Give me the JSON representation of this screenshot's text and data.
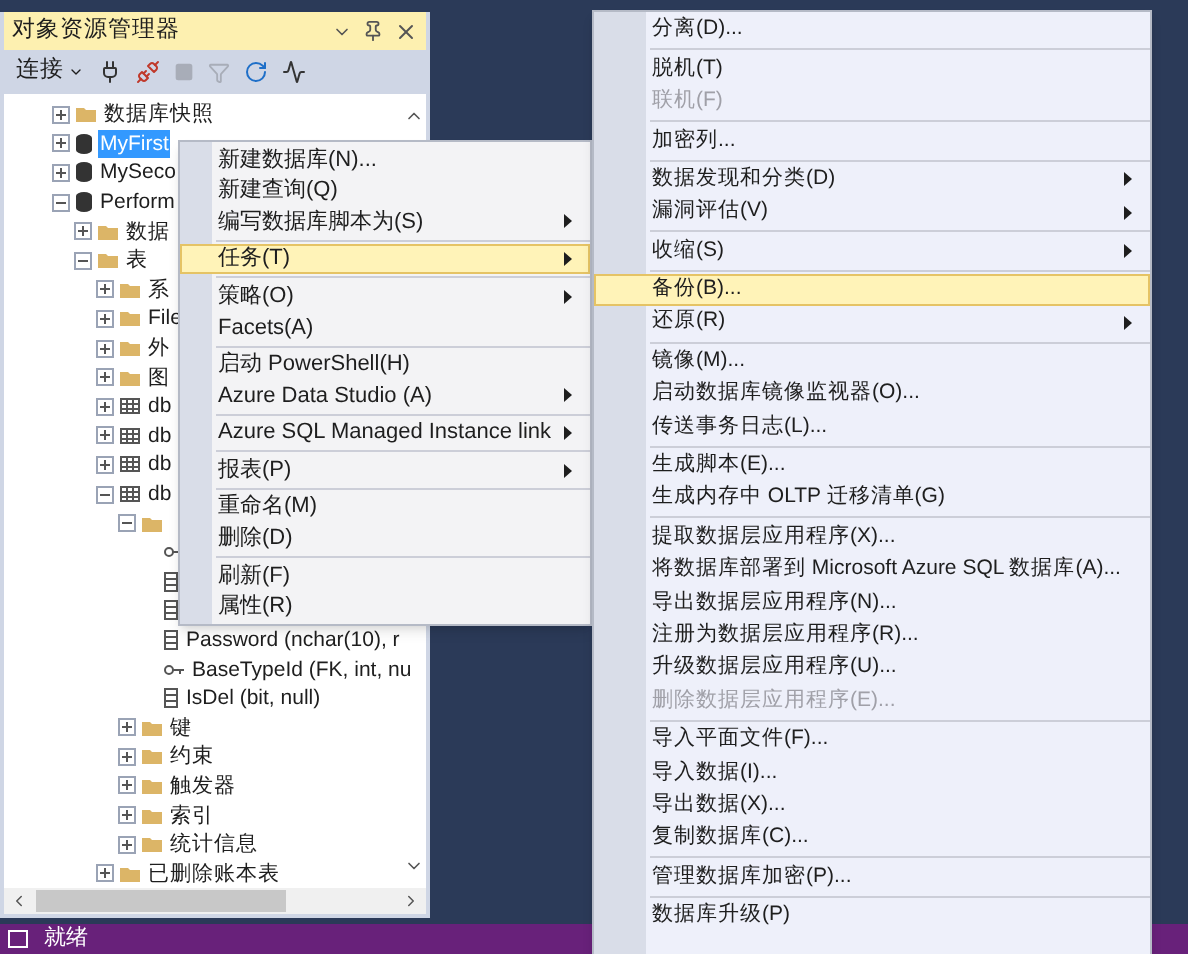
{
  "panel": {
    "title": "对象资源管理器",
    "toolbar": {
      "connect": "连接"
    }
  },
  "tree": [
    {
      "label": "数据库快照",
      "kind": "folder",
      "expanded": false,
      "selected": false
    },
    {
      "label": "MyFirst",
      "kind": "database",
      "expanded": false,
      "selected": true
    },
    {
      "label": "MySeco",
      "kind": "database",
      "expanded": false,
      "selected": false
    },
    {
      "label": "Perform",
      "kind": "database",
      "expanded": true,
      "selected": false,
      "children": [
        {
          "label": "数据",
          "kind": "folder",
          "expanded": false,
          "selected": false
        },
        {
          "label": "表",
          "kind": "folder",
          "expanded": true,
          "selected": false,
          "children": [
            {
              "label": "系",
              "kind": "folder",
              "expanded": false,
              "selected": false
            },
            {
              "label": "File",
              "kind": "folder",
              "expanded": false,
              "selected": false
            },
            {
              "label": "外",
              "kind": "folder",
              "expanded": false,
              "selected": false
            },
            {
              "label": "图",
              "kind": "folder",
              "expanded": false,
              "selected": false
            },
            {
              "label": "db",
              "kind": "table",
              "expanded": false,
              "selected": false
            },
            {
              "label": "db",
              "kind": "table",
              "expanded": false,
              "selected": false
            },
            {
              "label": "db",
              "kind": "table",
              "expanded": false,
              "selected": false
            },
            {
              "label": "db",
              "kind": "table",
              "expanded": true,
              "selected": false,
              "children": [
                {
                  "kind": "folder",
                  "expanded": true,
                  "selected": false,
                  "children": [
                    {
                      "kind": "key",
                      "selected": false
                    },
                    {
                      "kind": "column",
                      "selected": false
                    },
                    {
                      "kind": "column",
                      "selected": false
                    },
                    {
                      "label": "Password (nchar(10), r",
                      "kind": "column",
                      "selected": false
                    },
                    {
                      "label": "BaseTypeId (FK, int, nu",
                      "kind": "key",
                      "selected": false
                    },
                    {
                      "label": "IsDel (bit, null)",
                      "kind": "column",
                      "selected": false
                    }
                  ]
                },
                {
                  "label": "键",
                  "kind": "folder",
                  "expanded": false,
                  "selected": false
                },
                {
                  "label": "约束",
                  "kind": "folder",
                  "expanded": false,
                  "selected": false
                },
                {
                  "label": "触发器",
                  "kind": "folder",
                  "expanded": false,
                  "selected": false
                },
                {
                  "label": "索引",
                  "kind": "folder",
                  "expanded": false,
                  "selected": false
                },
                {
                  "label": "统计信息",
                  "kind": "folder",
                  "expanded": false,
                  "selected": false
                }
              ]
            },
            {
              "label": "已删除账本表",
              "kind": "folder",
              "expanded": false,
              "selected": false
            }
          ]
        }
      ]
    }
  ],
  "context_menu": [
    {
      "kind": "item",
      "label": "新建数据库(N)...",
      "selected": false,
      "disabled": false,
      "submenu": false
    },
    {
      "kind": "item",
      "label": "新建查询(Q)",
      "selected": false,
      "disabled": false,
      "submenu": false
    },
    {
      "kind": "item",
      "label": "编写数据库脚本为(S)",
      "selected": false,
      "disabled": false,
      "submenu": true
    },
    {
      "kind": "separator"
    },
    {
      "kind": "item",
      "label": "任务(T)",
      "selected": true,
      "disabled": false,
      "submenu": true
    },
    {
      "kind": "separator"
    },
    {
      "kind": "item",
      "label": "策略(O)",
      "selected": false,
      "disabled": false,
      "submenu": true
    },
    {
      "kind": "item",
      "label": "Facets(A)",
      "selected": false,
      "disabled": false,
      "submenu": false
    },
    {
      "kind": "separator"
    },
    {
      "kind": "item",
      "label": "启动 PowerShell(H)",
      "selected": false,
      "disabled": false,
      "submenu": false
    },
    {
      "kind": "item",
      "label": "Azure Data Studio (A)",
      "selected": false,
      "disabled": false,
      "submenu": true
    },
    {
      "kind": "separator"
    },
    {
      "kind": "item",
      "label": "Azure SQL Managed Instance link",
      "selected": false,
      "disabled": false,
      "submenu": true
    },
    {
      "kind": "separator"
    },
    {
      "kind": "item",
      "label": "报表(P)",
      "selected": false,
      "disabled": false,
      "submenu": true
    },
    {
      "kind": "separator"
    },
    {
      "kind": "item",
      "label": "重命名(M)",
      "selected": false,
      "disabled": false,
      "submenu": false
    },
    {
      "kind": "item",
      "label": "删除(D)",
      "selected": false,
      "disabled": false,
      "submenu": false
    },
    {
      "kind": "separator"
    },
    {
      "kind": "item",
      "label": "刷新(F)",
      "selected": false,
      "disabled": false,
      "submenu": false
    },
    {
      "kind": "item",
      "label": "属性(R)",
      "selected": false,
      "disabled": false,
      "submenu": false
    }
  ],
  "tasks_submenu": [
    {
      "kind": "item",
      "label": "分离(D)...",
      "selected": false,
      "disabled": false,
      "submenu": false
    },
    {
      "kind": "separator"
    },
    {
      "kind": "item",
      "label": "脱机(T)",
      "selected": false,
      "disabled": false,
      "submenu": false
    },
    {
      "kind": "item",
      "label": "联机(F)",
      "selected": false,
      "disabled": true,
      "submenu": false
    },
    {
      "kind": "separator"
    },
    {
      "kind": "item",
      "label": "加密列...",
      "selected": false,
      "disabled": false,
      "submenu": false
    },
    {
      "kind": "separator"
    },
    {
      "kind": "item",
      "label": "数据发现和分类(D)",
      "selected": false,
      "disabled": false,
      "submenu": true
    },
    {
      "kind": "item",
      "label": "漏洞评估(V)",
      "selected": false,
      "disabled": false,
      "submenu": true
    },
    {
      "kind": "separator"
    },
    {
      "kind": "item",
      "label": "收缩(S)",
      "selected": false,
      "disabled": false,
      "submenu": true
    },
    {
      "kind": "separator"
    },
    {
      "kind": "item",
      "label": "备份(B)...",
      "selected": true,
      "disabled": false,
      "submenu": false
    },
    {
      "kind": "item",
      "label": "还原(R)",
      "selected": false,
      "disabled": false,
      "submenu": true
    },
    {
      "kind": "separator"
    },
    {
      "kind": "item",
      "label": "镜像(M)...",
      "selected": false,
      "disabled": false,
      "submenu": false
    },
    {
      "kind": "item",
      "label": "启动数据库镜像监视器(O)...",
      "selected": false,
      "disabled": false,
      "submenu": false
    },
    {
      "kind": "item",
      "label": "传送事务日志(L)...",
      "selected": false,
      "disabled": false,
      "submenu": false
    },
    {
      "kind": "separator"
    },
    {
      "kind": "item",
      "label": "生成脚本(E)...",
      "selected": false,
      "disabled": false,
      "submenu": false
    },
    {
      "kind": "item",
      "label": "生成内存中 OLTP 迁移清单(G)",
      "selected": false,
      "disabled": false,
      "submenu": false
    },
    {
      "kind": "separator"
    },
    {
      "kind": "item",
      "label": "提取数据层应用程序(X)...",
      "selected": false,
      "disabled": false,
      "submenu": false
    },
    {
      "kind": "item",
      "label": "将数据库部署到 Microsoft Azure SQL 数据库(A)...",
      "selected": false,
      "disabled": false,
      "submenu": false
    },
    {
      "kind": "item",
      "label": "导出数据层应用程序(N)...",
      "selected": false,
      "disabled": false,
      "submenu": false
    },
    {
      "kind": "item",
      "label": "注册为数据层应用程序(R)...",
      "selected": false,
      "disabled": false,
      "submenu": false
    },
    {
      "kind": "item",
      "label": "升级数据层应用程序(U)...",
      "selected": false,
      "disabled": false,
      "submenu": false
    },
    {
      "kind": "item",
      "label": "删除数据层应用程序(E)...",
      "selected": false,
      "disabled": true,
      "submenu": false
    },
    {
      "kind": "separator"
    },
    {
      "kind": "item",
      "label": "导入平面文件(F)...",
      "selected": false,
      "disabled": false,
      "submenu": false
    },
    {
      "kind": "item",
      "label": "导入数据(I)...",
      "selected": false,
      "disabled": false,
      "submenu": false
    },
    {
      "kind": "item",
      "label": "导出数据(X)...",
      "selected": false,
      "disabled": false,
      "submenu": false
    },
    {
      "kind": "item",
      "label": "复制数据库(C)...",
      "selected": false,
      "disabled": false,
      "submenu": false
    },
    {
      "kind": "separator"
    },
    {
      "kind": "item",
      "label": "管理数据库加密(P)...",
      "selected": false,
      "disabled": false,
      "submenu": false
    },
    {
      "kind": "separator"
    },
    {
      "kind": "item",
      "label": "数据库升级(P)",
      "selected": false,
      "disabled": false,
      "submenu": false
    }
  ],
  "status_bar": {
    "text": "就绪"
  }
}
